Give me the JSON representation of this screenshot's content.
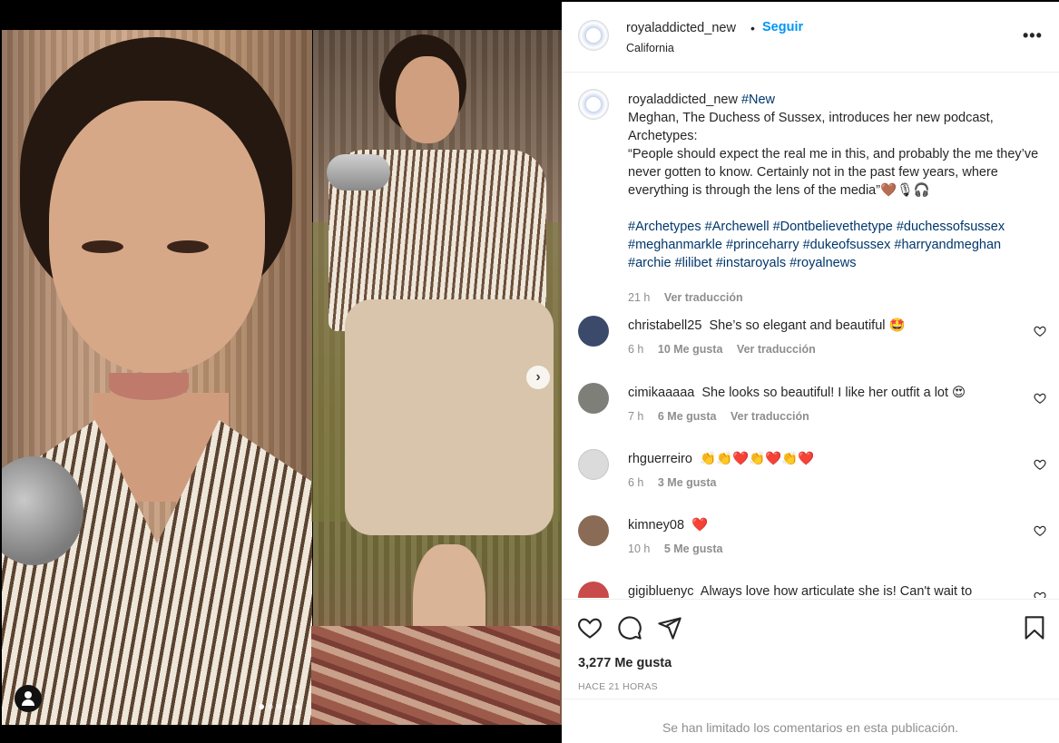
{
  "post": {
    "username": "royaladdicted_new",
    "separator": "•",
    "follow_label": "Seguir",
    "location": "California",
    "more_label": "•••"
  },
  "media": {
    "next_label": "›",
    "dots_total": 5,
    "dots_active": 0
  },
  "caption": {
    "username": "royaladdicted_new",
    "hashtag_first": "#New",
    "line1": "Meghan, The Duchess of Sussex, introduces her new podcast, Archetypes:",
    "quote": "“People should expect the real me in this, and probably the me they’ve never gotten to know. Certainly not in the past few years, where everything is through the lens of the media”🤎🎙🎧",
    "hashtags": "#Archetypes #Archewell #Dontbelievethetype #duchessofsussex #meghanmarkle #princeharry #dukeofsussex #harryandmeghan #archie #lilibet #instaroyals #royalnews",
    "time": "21 h",
    "translate_label": "Ver traducción"
  },
  "comments": [
    {
      "username": "christabell25",
      "text": "She’s so elegant and beautiful 🤩",
      "time": "6 h",
      "likes": "10 Me gusta",
      "translate": "Ver traducción",
      "avatar_color": "#3b4a6b"
    },
    {
      "username": "cimikaaaaa",
      "text": "She looks so beautiful! I like her outfit a lot 😍",
      "time": "7 h",
      "likes": "6 Me gusta",
      "translate": "Ver traducción",
      "avatar_color": "#7d7f78"
    },
    {
      "username": "rhguerreiro",
      "text": "👏👏❤️👏❤️👏❤️",
      "time": "6 h",
      "likes": "3 Me gusta",
      "translate": "",
      "avatar_color": "#dbdbdb"
    },
    {
      "username": "kimney08",
      "text": "❤️",
      "time": "10 h",
      "likes": "5 Me gusta",
      "translate": "",
      "avatar_color": "#8a6b55"
    },
    {
      "username": "gigibluenyc",
      "text": "Always love how articulate she is! Can't wait to",
      "time": "",
      "likes": "",
      "translate": "",
      "avatar_color": "#c94a4a"
    }
  ],
  "footer": {
    "likes": "3,277 Me gusta",
    "time": "HACE 21 HORAS",
    "limited_notice": "Se han limitado los comentarios en esta publicación."
  }
}
